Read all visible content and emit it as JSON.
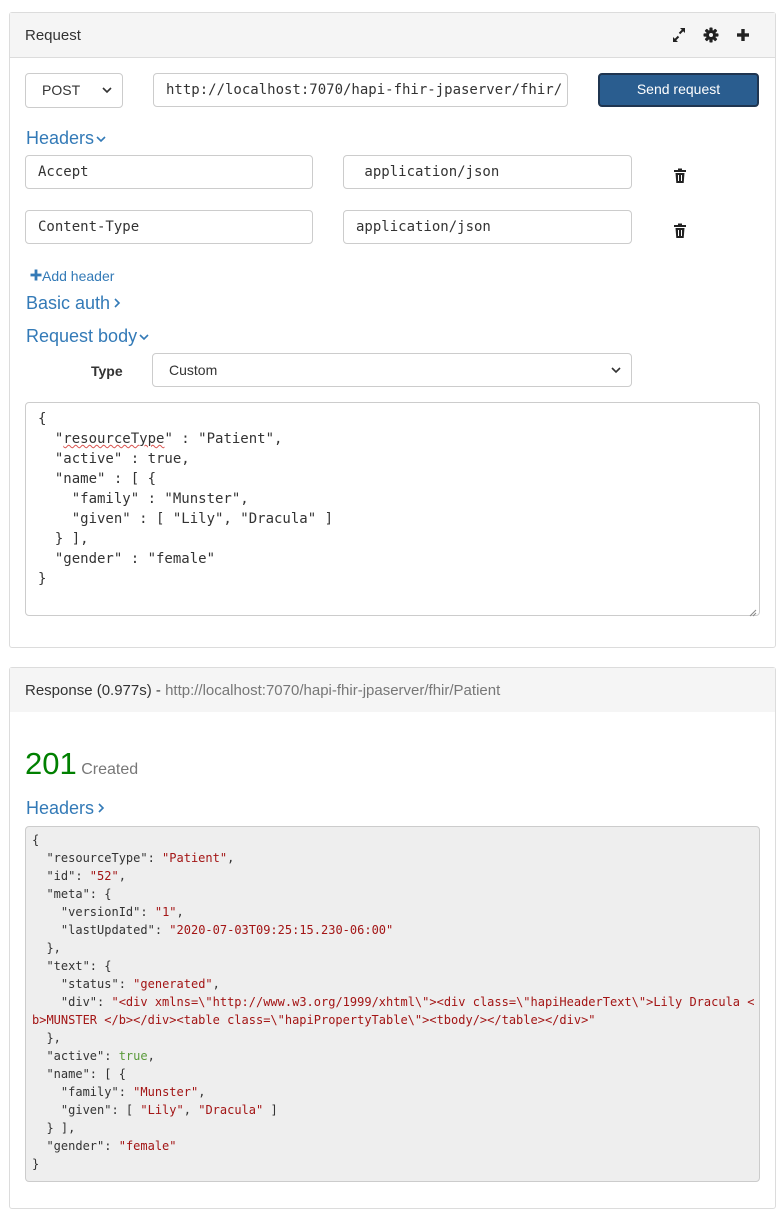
{
  "request": {
    "title": "Request",
    "method": "POST",
    "url": "http://localhost:7070/hapi-fhir-jpaserver/fhir/",
    "send_label": "Send request",
    "headers_label": "Headers",
    "headers": [
      {
        "name": "Accept",
        "value": " application/json"
      },
      {
        "name": "Content-Type",
        "value": "application/json"
      }
    ],
    "add_header_label": "Add header",
    "basic_auth_label": "Basic auth",
    "request_body_label": "Request body",
    "type_label": "Type",
    "type_value": "Custom",
    "body_lines": [
      "{",
      "  \"resourceType\" : \"Patient\",",
      "  \"active\" : true,",
      "  \"name\" : [ {",
      "    \"family\" : \"Munster\",",
      "    \"given\" : [ \"Lily\", \"Dracula\" ]",
      "  } ],",
      "  \"gender\" : \"female\"",
      "}"
    ]
  },
  "response": {
    "title_prefix": "Response (0.977s) - ",
    "title_url": "http://localhost:7070/hapi-fhir-jpaserver/fhir/Patient",
    "status_code": "201",
    "status_text": "Created",
    "headers_label": "Headers",
    "body": {
      "resourceType": "Patient",
      "id": "52",
      "versionId": "1",
      "lastUpdated": "2020-07-03T09:25:15.230-06:00",
      "status": "generated",
      "div_line1": "\"<div xmlns=\\\"http://www.w3.org/1999/xhtml\\\"><div class=\\\"hapiHeaderText\\\">Lily Dracula <",
      "div_line2": "b>MUNSTER </b></div><table class=\\\"hapiPropertyTable\\\"><tbody/></table></div>\"",
      "active": "true",
      "family": "Munster",
      "given1": "Lily",
      "given2": "Dracula",
      "gender": "female"
    }
  },
  "colors": {
    "link": "#337ab7",
    "primary": "#2a5d8f",
    "status_ok": "#008000",
    "string": "#a31515",
    "boolean": "#5a9a3a"
  },
  "icons": [
    "expand-icon",
    "gear-icon",
    "plus-icon",
    "trash-icon",
    "chevron-down-icon",
    "chevron-right-icon"
  ]
}
